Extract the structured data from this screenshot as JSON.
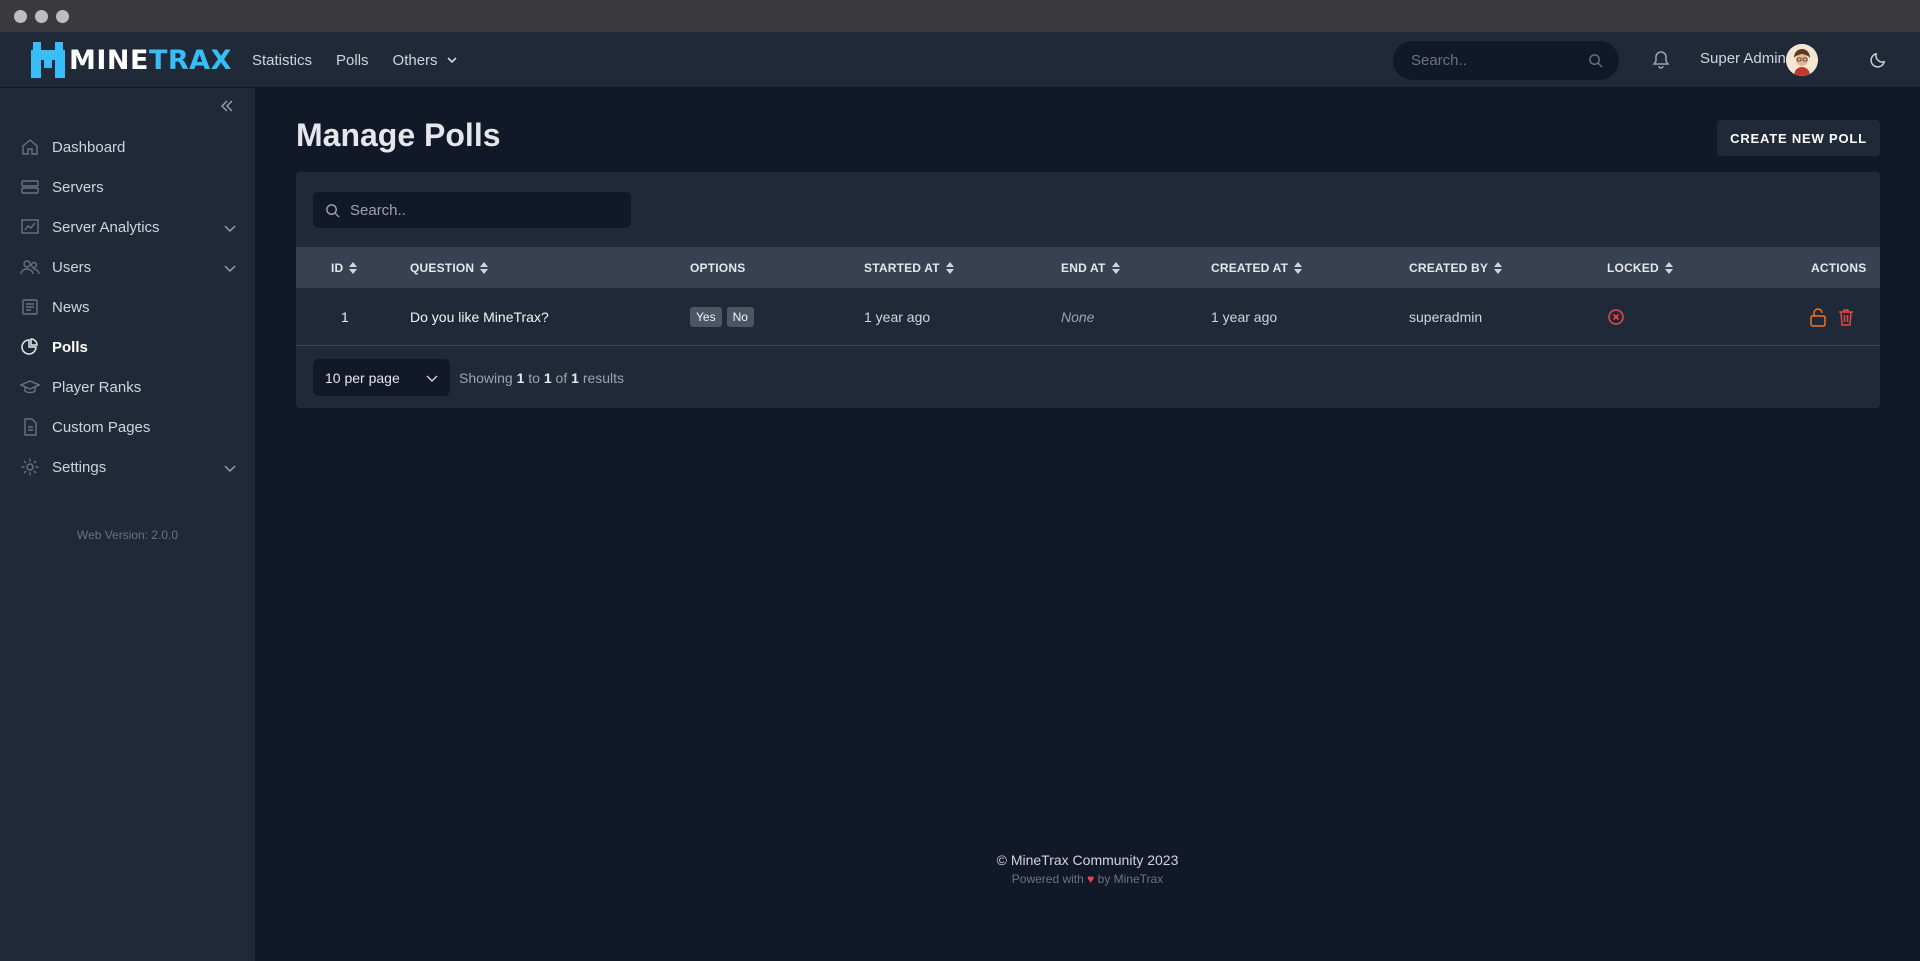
{
  "brand": {
    "name_left": "MINE",
    "name_right": "TRAX",
    "accent_color": "#38bdf8"
  },
  "topnav": {
    "links": [
      "Statistics",
      "Polls",
      "Others"
    ],
    "search_placeholder": "Search..",
    "user_name": "Super Admin"
  },
  "sidebar": {
    "items": [
      {
        "label": "Dashboard",
        "icon": "home-icon"
      },
      {
        "label": "Servers",
        "icon": "server-icon"
      },
      {
        "label": "Server Analytics",
        "icon": "chart-icon",
        "expandable": true
      },
      {
        "label": "Users",
        "icon": "users-icon",
        "expandable": true
      },
      {
        "label": "News",
        "icon": "newspaper-icon"
      },
      {
        "label": "Polls",
        "icon": "pie-chart-icon",
        "active": true
      },
      {
        "label": "Player Ranks",
        "icon": "academic-cap-icon"
      },
      {
        "label": "Custom Pages",
        "icon": "document-icon"
      },
      {
        "label": "Settings",
        "icon": "gear-icon",
        "expandable": true
      }
    ],
    "web_version": "Web Version: 2.0.0"
  },
  "main": {
    "title": "Manage Polls",
    "create_button": "CREATE NEW POLL",
    "table_search_placeholder": "Search..",
    "columns": [
      "ID",
      "QUESTION",
      "OPTIONS",
      "STARTED AT",
      "END AT",
      "CREATED AT",
      "CREATED BY",
      "LOCKED",
      "ACTIONS"
    ],
    "rows": [
      {
        "id": "1",
        "question": "Do you like MineTrax?",
        "options": [
          "Yes",
          "No"
        ],
        "started_at": "1 year ago",
        "end_at": "None",
        "created_at": "1 year ago",
        "created_by": "superadmin",
        "locked": false
      }
    ],
    "per_page": "10 per page",
    "showing": {
      "prefix": "Showing",
      "from": "1",
      "to_word": "to",
      "to": "1",
      "of_word": "of",
      "total": "1",
      "suffix": "results"
    }
  },
  "footer": {
    "copyright": "© MineTrax Community 2023",
    "powered_prefix": "Powered with",
    "powered_suffix": "by MineTrax"
  }
}
